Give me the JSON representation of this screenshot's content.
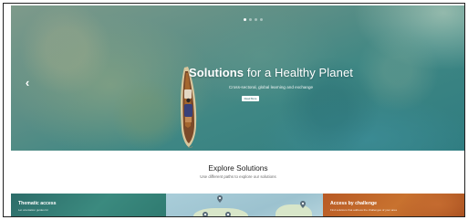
{
  "hero": {
    "title_bold": "Solutions",
    "title_rest": " for a Healthy Planet",
    "subtitle": "Cross-sectoral, global learning and exchange",
    "button_label": "Read More",
    "prev_arrow": "‹",
    "next_arrow": "›",
    "slide_count": 4,
    "active_slide": 1
  },
  "explore": {
    "title": "Explore Solutions",
    "subtitle": "Use different paths to explore our solutions"
  },
  "cards": [
    {
      "title": "Thematic access",
      "text": "Let orientation guides for"
    },
    {
      "title": "",
      "text": ""
    },
    {
      "title": "Access by challenge",
      "text": "Find solutions that address the challenges of your area"
    }
  ],
  "colors": {
    "hero_teal": "#2f7c80",
    "card_green": "#2c6c69",
    "card_map": "#a9cdd9",
    "card_orange": "#b85a25"
  },
  "icons": [
    "chevron-left-icon",
    "chevron-right-icon",
    "map-pin-icon"
  ]
}
